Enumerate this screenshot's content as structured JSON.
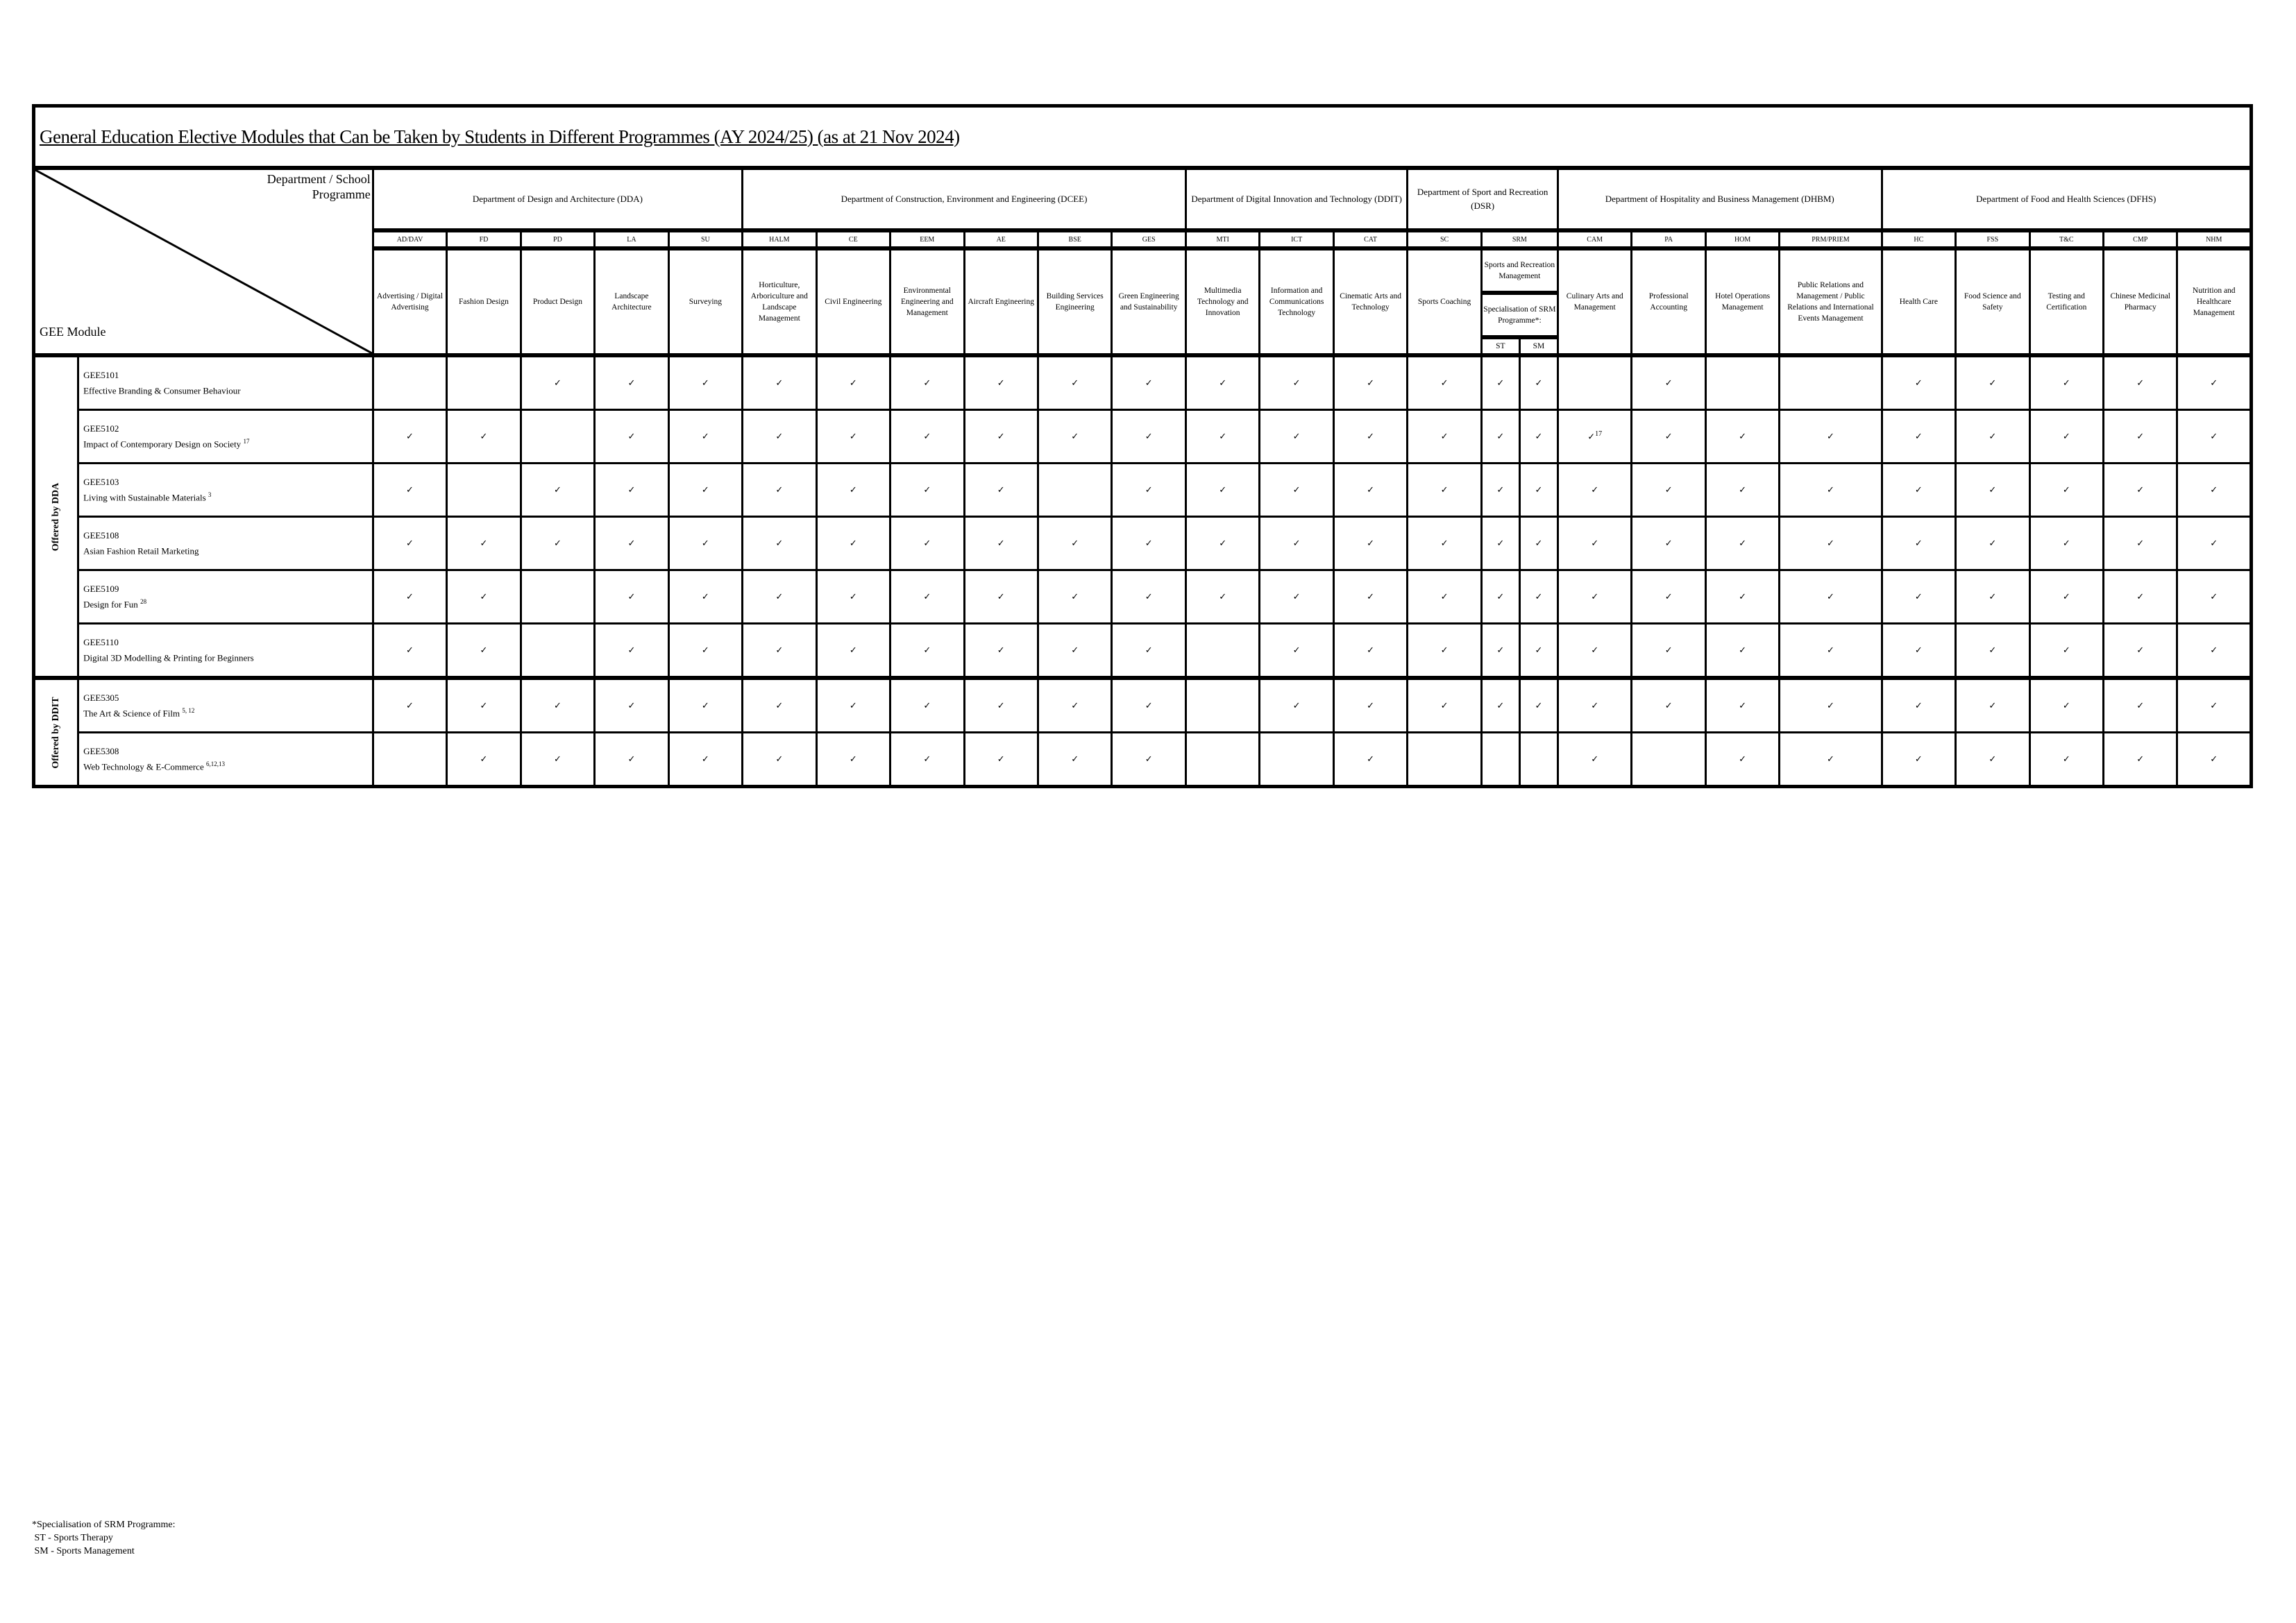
{
  "title": "General Education Elective Modules that Can be Taken by Students in Different Programmes (AY 2024/25) (as at 21 Nov 2024)",
  "corner": {
    "top_label": "Department / School Programme",
    "top_label_line1": "Department / School",
    "top_label_line2": "Programme",
    "bottom_label": "GEE Module"
  },
  "check_glyph": "✓",
  "departments": [
    {
      "name": "Department of Design and Architecture (DDA)",
      "span": 5
    },
    {
      "name": "Department of Construction, Environment and Engineering (DCEE)",
      "span": 6
    },
    {
      "name": "Department of Digital Innovation and Technology (DDIT)",
      "span": 3
    },
    {
      "name": "Department of Sport and Recreation (DSR)",
      "span": 3
    },
    {
      "name": "Department of Hospitality and Business Management (DHBM)",
      "span": 4
    },
    {
      "name": "Department of Food and Health Sciences (DFHS)",
      "span": 5
    }
  ],
  "programmes": [
    {
      "code": "AD/DAV",
      "name": "Advertising / Digital Advertising"
    },
    {
      "code": "FD",
      "name": "Fashion Design"
    },
    {
      "code": "PD",
      "name": "Product Design"
    },
    {
      "code": "LA",
      "name": "Landscape Architecture"
    },
    {
      "code": "SU",
      "name": "Surveying"
    },
    {
      "code": "HALM",
      "name": "Horticulture, Arboriculture and Landscape Management"
    },
    {
      "code": "CE",
      "name": "Civil Engineering"
    },
    {
      "code": "EEM",
      "name": "Environmental Engineering and Management"
    },
    {
      "code": "AE",
      "name": "Aircraft Engineering"
    },
    {
      "code": "BSE",
      "name": "Building Services Engineering"
    },
    {
      "code": "GES",
      "name": "Green Engineering and Sustainability"
    },
    {
      "code": "MTI",
      "name": "Multimedia Technology and Innovation"
    },
    {
      "code": "ICT",
      "name": "Information and Communications Technology"
    },
    {
      "code": "CAT",
      "name": "Cinematic Arts and Technology"
    },
    {
      "code": "SC",
      "name": "Sports Coaching"
    },
    {
      "code": "SRM",
      "name": "Sports and Recreation Management",
      "specialisation_label": "Specialisation of SRM Programme*:",
      "sub": [
        "ST",
        "SM"
      ]
    },
    {
      "code": "CAM",
      "name": "Culinary Arts and Management"
    },
    {
      "code": "PA",
      "name": "Professional Accounting"
    },
    {
      "code": "HOM",
      "name": "Hotel Operations Management"
    },
    {
      "code": "PRM/PRIEM",
      "name": "Public Relations and Management / Public Relations and International Events Management"
    },
    {
      "code": "HC",
      "name": "Health Care"
    },
    {
      "code": "FSS",
      "name": "Food Science and Safety"
    },
    {
      "code": "T&C",
      "name": "Testing and Certification"
    },
    {
      "code": "CMP",
      "name": "Chinese Medicinal Pharmacy"
    },
    {
      "code": "NHM",
      "name": "Nutrition and Healthcare Management"
    }
  ],
  "column_keys": [
    "AD/DAV",
    "FD",
    "PD",
    "LA",
    "SU",
    "HALM",
    "CE",
    "EEM",
    "AE",
    "BSE",
    "GES",
    "MTI",
    "ICT",
    "CAT",
    "SC",
    "SRM-ST",
    "SRM-SM",
    "CAM",
    "PA",
    "HOM",
    "PRM/PRIEM",
    "HC",
    "FSS",
    "T&C",
    "CMP",
    "NHM"
  ],
  "groups": [
    {
      "label": "Offered by DDA",
      "modules": [
        {
          "code": "GEE5101",
          "title": "Effective Branding & Consumer Behaviour",
          "note": "",
          "cells": [
            "",
            "",
            "✓",
            "✓",
            "✓",
            "✓",
            "✓",
            "✓",
            "✓",
            "✓",
            "✓",
            "✓",
            "✓",
            "✓",
            "✓",
            "✓",
            "✓",
            "",
            "✓",
            "",
            "",
            "✓",
            "✓",
            "✓",
            "✓",
            "✓"
          ]
        },
        {
          "code": "GEE5102",
          "title": "Impact of Contemporary Design on Society",
          "note": "17",
          "cells": [
            "✓",
            "✓",
            "",
            "✓",
            "✓",
            "✓",
            "✓",
            "✓",
            "✓",
            "✓",
            "✓",
            "✓",
            "✓",
            "✓",
            "✓",
            "✓",
            "✓",
            "✓17",
            "✓",
            "✓",
            "✓",
            "✓",
            "✓",
            "✓",
            "✓",
            "✓"
          ]
        },
        {
          "code": "GEE5103",
          "title": "Living with Sustainable Materials",
          "note": "3",
          "cells": [
            "✓",
            "",
            "✓",
            "✓",
            "✓",
            "✓",
            "✓",
            "✓",
            "✓",
            "",
            "✓",
            "✓",
            "✓",
            "✓",
            "✓",
            "✓",
            "✓",
            "✓",
            "✓",
            "✓",
            "✓",
            "✓",
            "✓",
            "✓",
            "✓",
            "✓"
          ]
        },
        {
          "code": "GEE5108",
          "title": "Asian Fashion Retail Marketing",
          "note": "",
          "cells": [
            "✓",
            "✓",
            "✓",
            "✓",
            "✓",
            "✓",
            "✓",
            "✓",
            "✓",
            "✓",
            "✓",
            "✓",
            "✓",
            "✓",
            "✓",
            "✓",
            "✓",
            "✓",
            "✓",
            "✓",
            "✓",
            "✓",
            "✓",
            "✓",
            "✓",
            "✓"
          ]
        },
        {
          "code": "GEE5109",
          "title": "Design for Fun",
          "note": "28",
          "cells": [
            "✓",
            "✓",
            "",
            "✓",
            "✓",
            "✓",
            "✓",
            "✓",
            "✓",
            "✓",
            "✓",
            "✓",
            "✓",
            "✓",
            "✓",
            "✓",
            "✓",
            "✓",
            "✓",
            "✓",
            "✓",
            "✓",
            "✓",
            "✓",
            "✓",
            "✓"
          ]
        },
        {
          "code": "GEE5110",
          "title": "Digital 3D Modelling & Printing for Beginners",
          "note": "",
          "cells": [
            "✓",
            "✓",
            "",
            "✓",
            "✓",
            "✓",
            "✓",
            "✓",
            "✓",
            "✓",
            "✓",
            "",
            "✓",
            "✓",
            "✓",
            "✓",
            "✓",
            "✓",
            "✓",
            "✓",
            "✓",
            "✓",
            "✓",
            "✓",
            "✓",
            "✓"
          ]
        }
      ]
    },
    {
      "label": "Offered by DDIT",
      "modules": [
        {
          "code": "GEE5305",
          "title": "The Art & Science of Film",
          "note": "5, 12",
          "cells": [
            "✓",
            "✓",
            "✓",
            "✓",
            "✓",
            "✓",
            "✓",
            "✓",
            "✓",
            "✓",
            "✓",
            "",
            "✓",
            "✓",
            "✓",
            "✓",
            "✓",
            "✓",
            "✓",
            "✓",
            "✓",
            "✓",
            "✓",
            "✓",
            "✓",
            "✓"
          ]
        },
        {
          "code": "GEE5308",
          "title": "Web Technology & E-Commerce",
          "note": "6,12,13",
          "cells": [
            "",
            "✓",
            "✓",
            "✓",
            "✓",
            "✓",
            "✓",
            "✓",
            "✓",
            "✓",
            "✓",
            "",
            "",
            "✓",
            "",
            "",
            "",
            "✓",
            "",
            "✓",
            "✓",
            "✓",
            "✓",
            "✓",
            "✓",
            "✓"
          ]
        }
      ]
    }
  ],
  "footnote": {
    "heading": "*Specialisation of SRM Programme:",
    "lines": [
      " ST - Sports Therapy",
      " SM - Sports Management"
    ]
  }
}
